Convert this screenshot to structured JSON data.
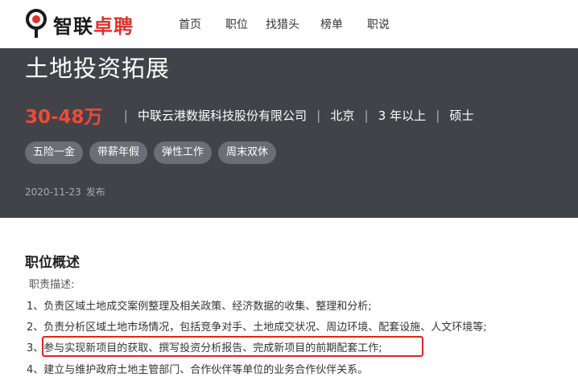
{
  "header": {
    "logo": {
      "text_a": "智联",
      "text_b": "卓聘"
    },
    "nav": [
      "首页",
      "职位",
      "找猎头",
      "榜单",
      "职说"
    ]
  },
  "job": {
    "title": "土地投资拓展",
    "salary": "30-48万",
    "company": "中联云港数据科技股份有限公司",
    "city": "北京",
    "experience": "3 年以上",
    "education": "硕士",
    "separator": "|",
    "tags": [
      "五险一金",
      "带薪年假",
      "弹性工作",
      "周末双休"
    ],
    "date": "2020-11-23",
    "date_suffix": "发布"
  },
  "description": {
    "section_title": "职位概述",
    "label": "职责描述:",
    "duties": [
      "1、负责区域土地成交案例整理及相关政策、经济数据的收集、整理和分析;",
      "2、负责分析区域土地市场情况，包括竞争对手、土地成交状况、周边环境、配套设施、人文环境等;",
      "3、参与实现新项目的获取、撰写投资分析报告、完成新项目的前期配套工作;",
      "4、建立与维护政府土地主管部门、合作伙伴等单位的业务合作伙伴关系。"
    ]
  },
  "colors": {
    "brand_red": "#e2312b",
    "salary": "#f04a36",
    "banner_bg": "#414349",
    "highlight": "#e3241e"
  }
}
